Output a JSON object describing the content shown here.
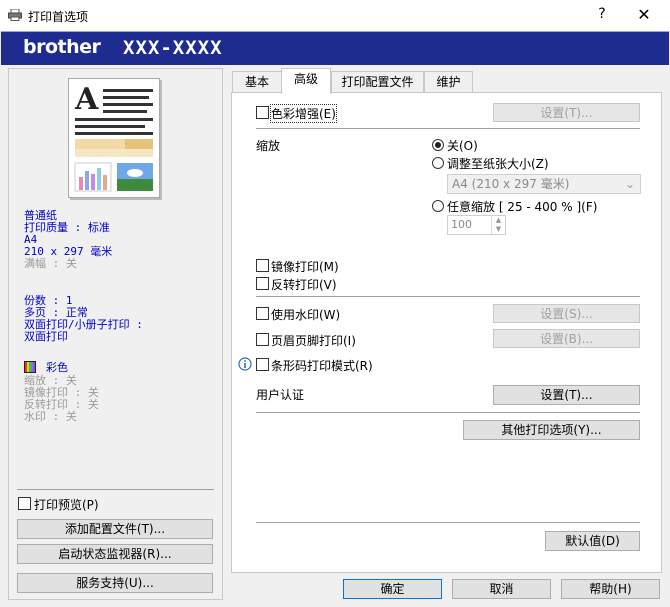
{
  "window": {
    "title": "打印首选项",
    "help_label": "?",
    "close_label": "✕"
  },
  "brand": {
    "logo": "brother",
    "model": "XXX-XXXX",
    "bar_color": "#1e2c8f"
  },
  "settings_summary": {
    "paper": "普通纸",
    "quality": "打印质量 : 标准",
    "size_name": "A4",
    "size_dim": "210 x 297 毫米",
    "borderless": "满幅 : 关",
    "copies": "份数 : 1",
    "multipage": "多页 : 正常",
    "duplex_label": "双面打印/小册子打印 :",
    "duplex_value": "双面打印",
    "color": "彩色",
    "scaling": "缩放 : 关",
    "mirror": "镜像打印 : 关",
    "reverse": "反转打印 : 关",
    "watermark": "水印 : 关"
  },
  "left": {
    "print_preview": "打印预览(P)",
    "add_profile": "添加配置文件(T)...",
    "status_monitor": "启动状态监视器(R)...",
    "support": "服务支持(U)..."
  },
  "tabs": [
    {
      "label": "基本"
    },
    {
      "label": "高级"
    },
    {
      "label": "打印配置文件"
    },
    {
      "label": "维护"
    }
  ],
  "advanced": {
    "color_enhance": "色彩增强(E)",
    "settings_T": "设置(T)...",
    "scaling_label": "缩放",
    "scaling_off": "关(O)",
    "fit_to_paper": "调整至纸张大小(Z)",
    "fit_select": "A4 (210 x 297 毫米)",
    "free_scaling": "任意缩放 [ 25 - 400 % ](F)",
    "free_value": "100",
    "mirror_print": "镜像打印(M)",
    "reverse_print": "反转打印(V)",
    "use_watermark": "使用水印(W)",
    "settings_S": "设置(S)...",
    "header_footer": "页眉页脚打印(I)",
    "settings_B": "设置(B)...",
    "barcode_mode": "条形码打印模式(R)",
    "user_auth": "用户认证",
    "settings_T2": "设置(T)...",
    "other_options": "其他打印选项(Y)...",
    "default": "默认值(D)"
  },
  "footer": {
    "ok": "确定",
    "cancel": "取消",
    "help": "帮助(H)"
  }
}
